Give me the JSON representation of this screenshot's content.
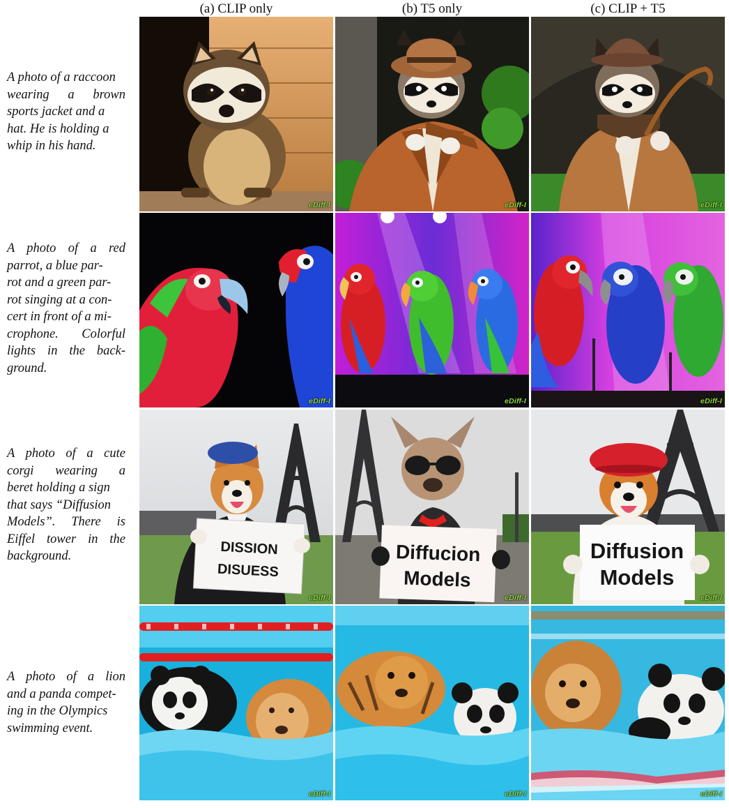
{
  "columns": [
    {
      "label": "(a) CLIP only"
    },
    {
      "label": "(b) T5 only"
    },
    {
      "label": "(c) CLIP + T5"
    }
  ],
  "rows": [
    {
      "prompt": "A photo of a raccoon wearing a brown sports jacket and a hat. He is holding a whip in his hand.",
      "prompt_lines": [
        "A photo of a raccoon",
        "wearing a brown",
        "sports jacket and a",
        "hat. He is holding a",
        "whip in his hand."
      ]
    },
    {
      "prompt": "A photo of a red parrot, a blue parrot and a green parrot singing at a concert in front of a microphone. Colorful lights in the background.",
      "prompt_lines": [
        "A photo of a red",
        "parrot, a blue par-",
        "rot and a green par-",
        "rot singing at a con-",
        "cert in front of a mi-",
        "crophone. Colorful",
        "lights in the back-",
        "ground."
      ]
    },
    {
      "prompt": "A photo of a cute corgi wearing a beret holding a sign that says “Diffusion Models”. There is Eiffel tower in the background.",
      "prompt_lines": [
        "A photo of a cute",
        "corgi wearing a",
        "beret holding a sign",
        "that says “Diffusion",
        "Models”. There is",
        "Eiffel tower in the",
        "background."
      ]
    },
    {
      "prompt": "A photo of a lion and a panda competing in the Olympics swimming event.",
      "prompt_lines": [
        "A photo of a lion",
        "and a panda compet-",
        "ing in the Olympics",
        "swimming event."
      ]
    }
  ],
  "signs": {
    "clip_only": [
      "DISSION",
      "DISUESS"
    ],
    "t5_only": [
      "Diffucion",
      "Models"
    ],
    "clip_t5": [
      "Diffusion",
      "Models"
    ]
  },
  "watermark": "eDiff-I",
  "colors": {
    "watermark": "#8dd93e"
  }
}
